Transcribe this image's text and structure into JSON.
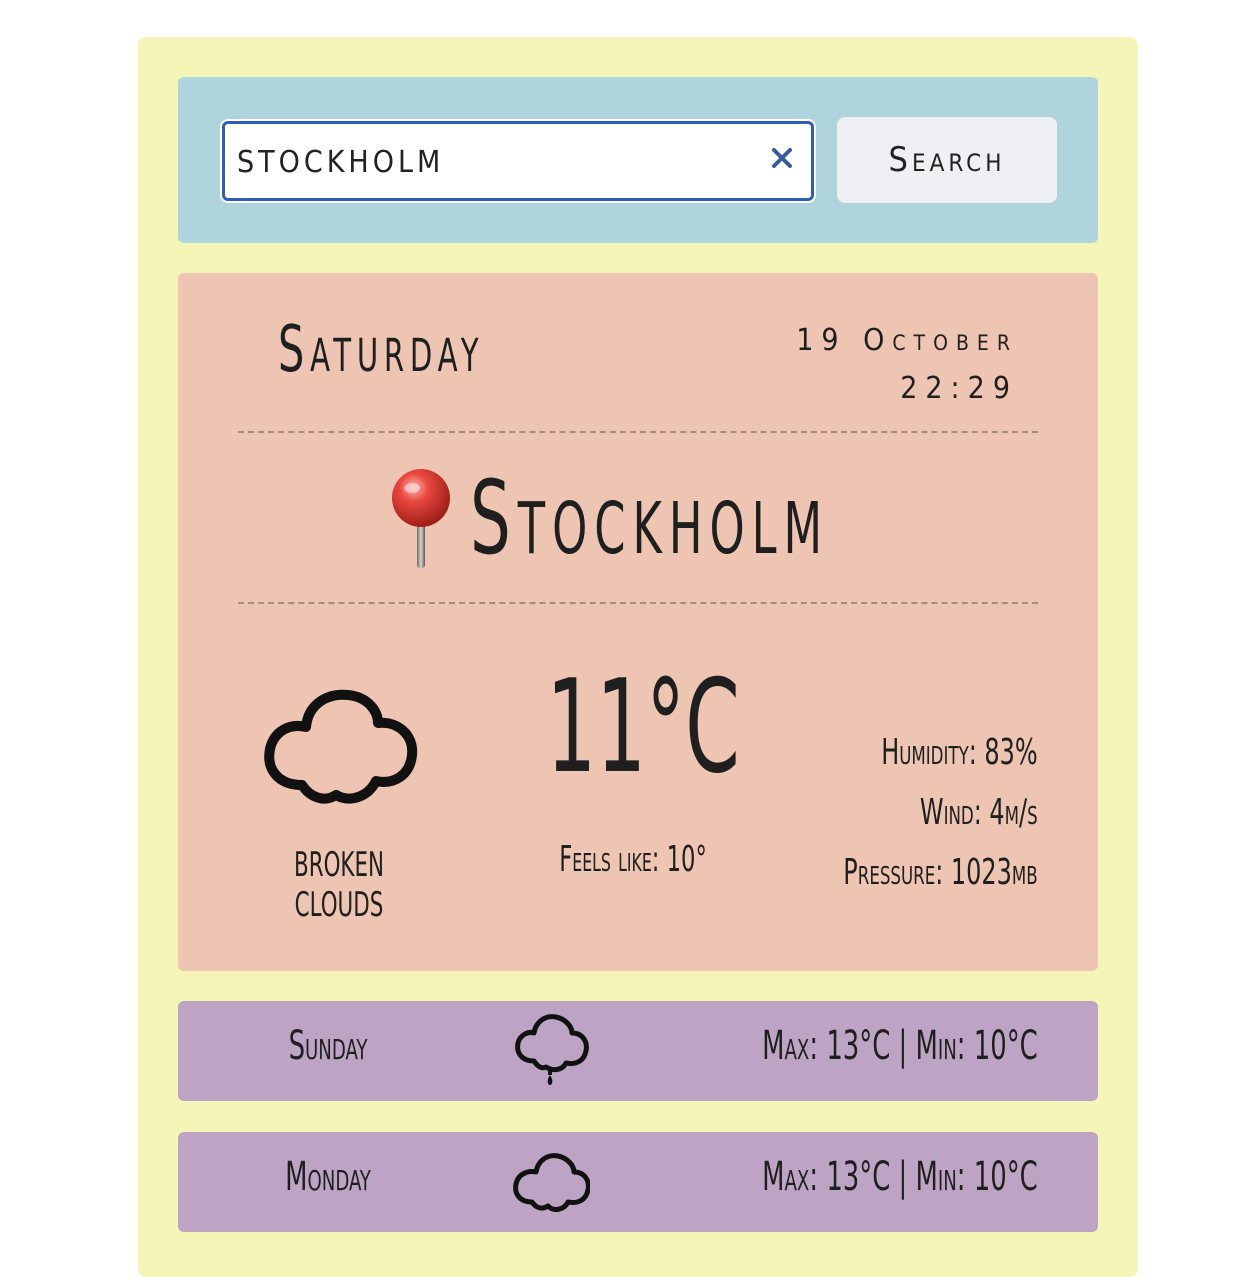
{
  "search": {
    "value": "STOCKHOLM",
    "placeholder": "",
    "button_label": "Search"
  },
  "current": {
    "day": "Saturday",
    "date": "19 October",
    "time": "22:29",
    "city": "Stockholm",
    "pin_icon": "round-pushpin-icon",
    "condition": "broken clouds",
    "condition_icon": "cloud-icon",
    "temperature": "11°C",
    "feels_like": "Feels like: 10°",
    "humidity": "Humidity: 83%",
    "wind": "Wind: 4m/s",
    "pressure": "Pressure: 1023mb"
  },
  "forecast": [
    {
      "day": "Sunday",
      "icon": "cloud-rain-drop-icon",
      "temps": "Max: 13°C | Min: 10°C"
    },
    {
      "day": "Monday",
      "icon": "cloud-icon",
      "temps": "Max: 13°C | Min: 10°C"
    }
  ],
  "colors": {
    "app_background": "#f4f5b6",
    "search_panel": "#afd4dc",
    "current_card": "#edc5b2",
    "forecast_row": "#bea4c4",
    "input_focus_border": "#2f5eb6"
  }
}
